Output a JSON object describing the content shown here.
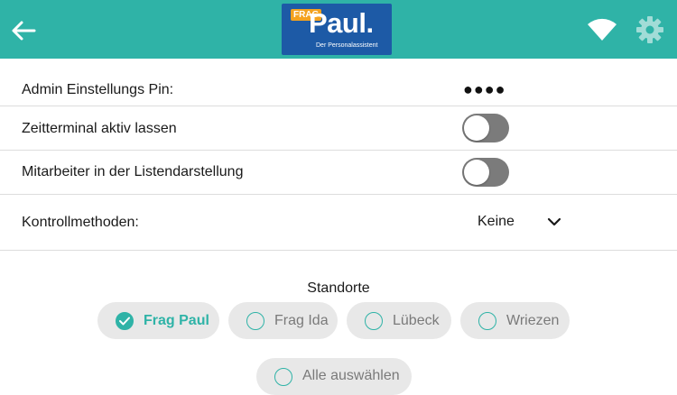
{
  "header": {
    "logo": {
      "frag": "FRAG",
      "name": "Paul.",
      "tagline": "Der Personalassistent"
    },
    "colors": {
      "bar": "#2fb3a7",
      "logo_bg": "#1d5aa6",
      "logo_tag": "#f4a21f"
    },
    "icons": [
      "back-arrow-icon",
      "wifi-icon",
      "gear-icon"
    ]
  },
  "settings": {
    "pin": {
      "label": "Admin Einstellungs Pin:",
      "value": "●●●●"
    },
    "terminal": {
      "label": "Zeitterminal aktiv lassen",
      "enabled": false
    },
    "list_view": {
      "label": "Mitarbeiter in der Listendarstellung",
      "enabled": false
    },
    "control": {
      "label": "Kontrollmethoden:",
      "value": "Keine"
    }
  },
  "locations": {
    "title": "Standorte",
    "items": [
      {
        "label": "Frag Paul",
        "selected": true
      },
      {
        "label": "Frag Ida",
        "selected": false
      },
      {
        "label": "Lübeck",
        "selected": false
      },
      {
        "label": "Wriezen",
        "selected": false
      }
    ],
    "select_all": "Alle auswählen"
  }
}
